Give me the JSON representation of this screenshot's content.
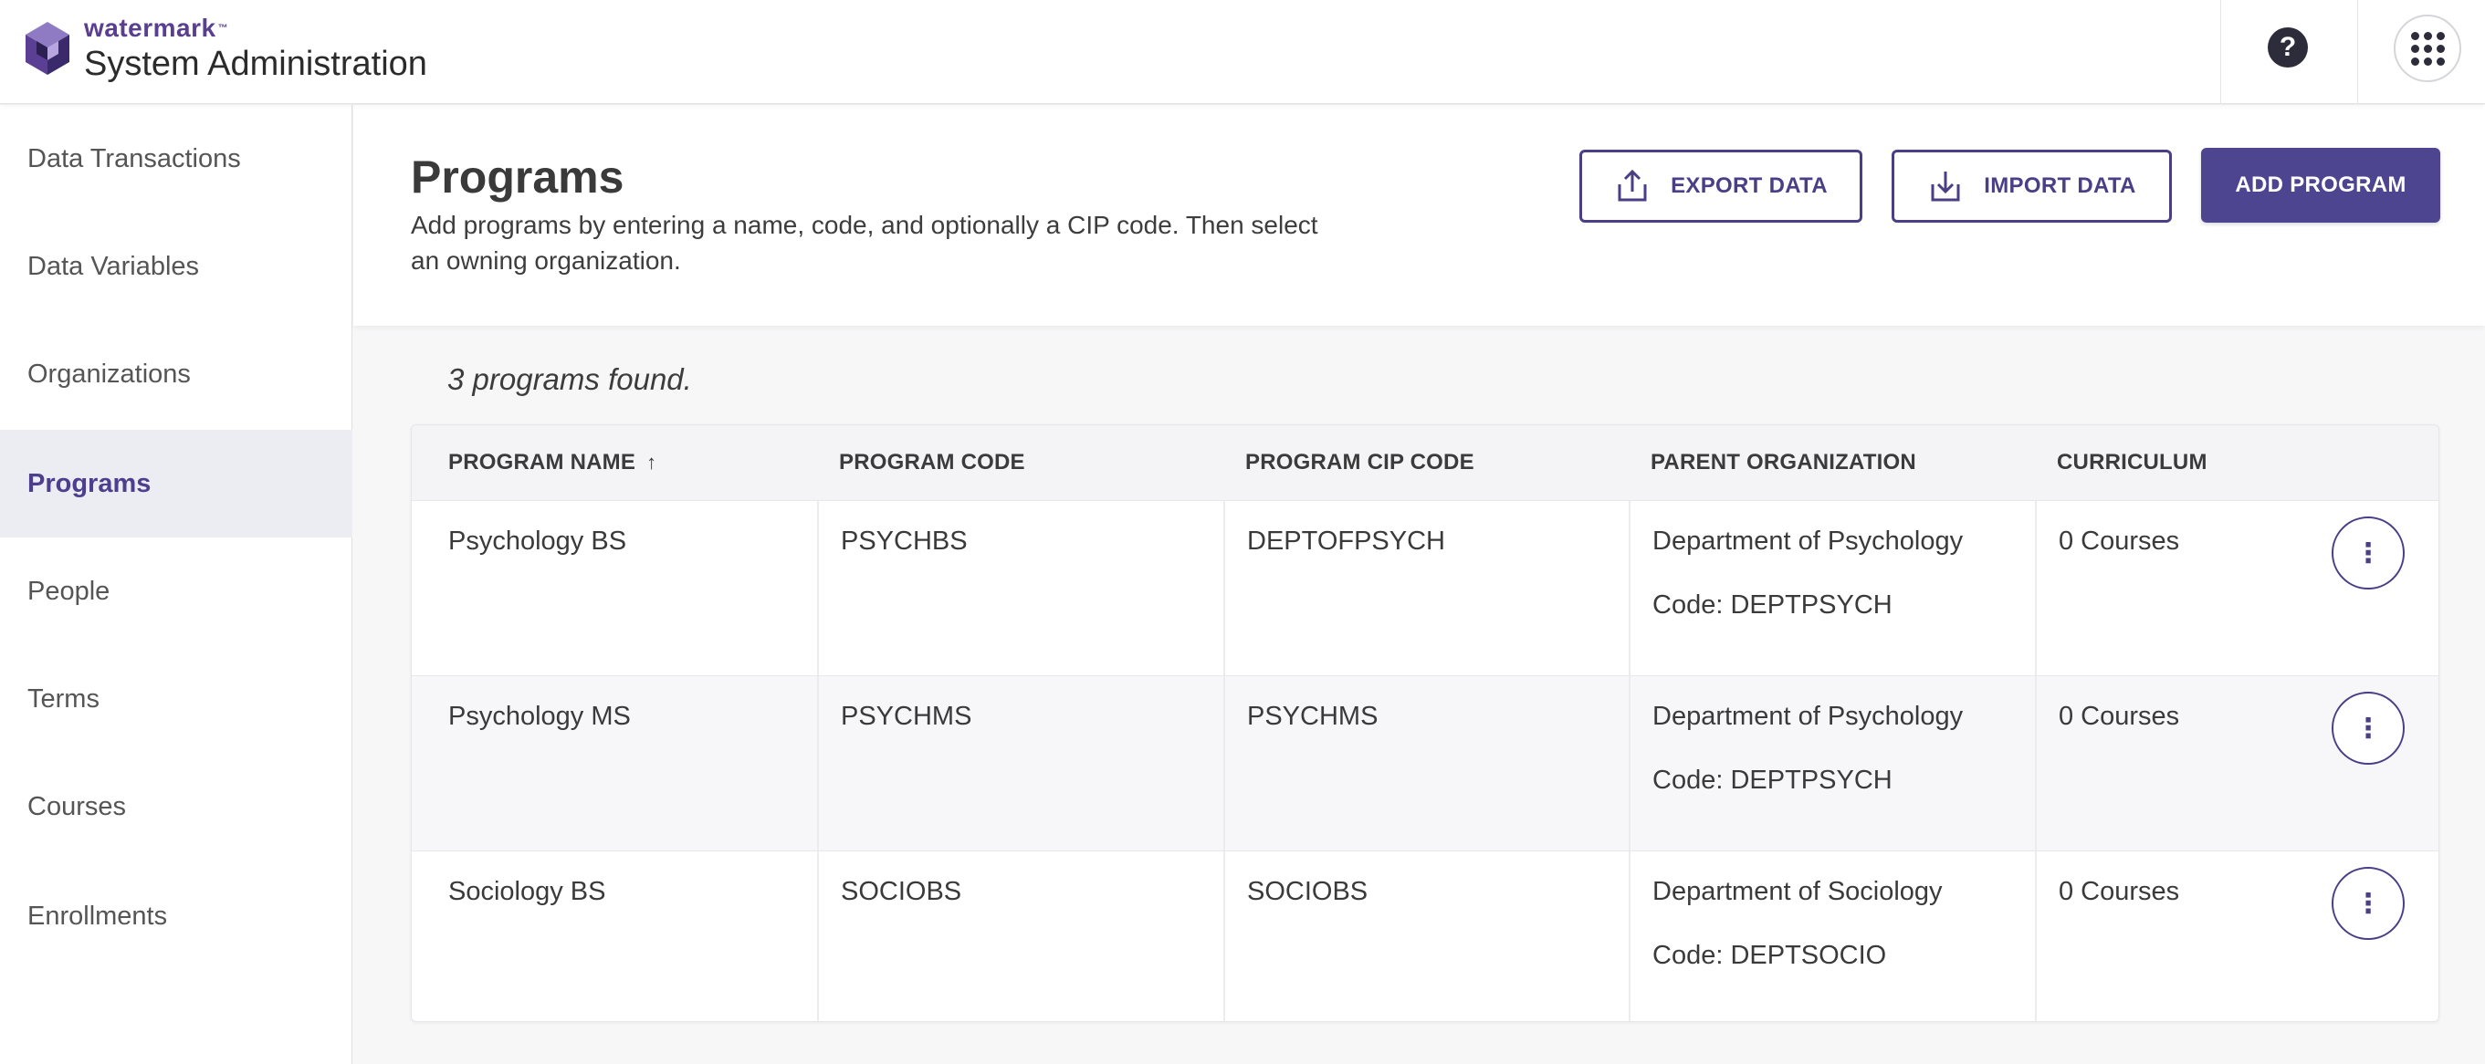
{
  "header": {
    "brand_mark": "watermark",
    "brand_tm": "™",
    "app_title": "System Administration",
    "help_glyph": "?",
    "icons": {
      "logo": "watermark-logo-icon",
      "help": "help-icon",
      "apps": "app-grid-icon"
    }
  },
  "sidebar": {
    "items": [
      {
        "label": "Data Transactions",
        "active": false
      },
      {
        "label": "Data Variables",
        "active": false
      },
      {
        "label": "Organizations",
        "active": false
      },
      {
        "label": "Programs",
        "active": true
      },
      {
        "label": "People",
        "active": false
      },
      {
        "label": "Terms",
        "active": false
      },
      {
        "label": "Courses",
        "active": false
      },
      {
        "label": "Enrollments",
        "active": false
      }
    ]
  },
  "page": {
    "title": "Programs",
    "description": "Add programs by entering a name, code, and optionally a CIP code. Then select an owning organization.",
    "buttons": {
      "export": "EXPORT DATA",
      "import": "IMPORT DATA",
      "add": "ADD PROGRAM"
    },
    "results_text": "3 programs found."
  },
  "table": {
    "columns": {
      "name": "PROGRAM NAME",
      "sort_indicator": "↑",
      "code": "PROGRAM CODE",
      "cip": "PROGRAM CIP CODE",
      "parent": "PARENT ORGANIZATION",
      "curriculum": "CURRICULUM"
    },
    "rows": [
      {
        "name": "Psychology BS",
        "code": "PSYCHBS",
        "cip": "DEPTOFPSYCH",
        "parent_org": "Department of Psychology",
        "parent_code": "Code: DEPTPSYCH",
        "curriculum": "0 Courses",
        "menu": "⋮"
      },
      {
        "name": "Psychology MS",
        "code": "PSYCHMS",
        "cip": "PSYCHMS",
        "parent_org": "Department of Psychology",
        "parent_code": "Code: DEPTPSYCH",
        "curriculum": "0 Courses",
        "menu": "⋮"
      },
      {
        "name": "Sociology BS",
        "code": "SOCIOBS",
        "cip": "SOCIOBS",
        "parent_org": "Department of Sociology",
        "parent_code": "Code: DEPTSOCIO",
        "curriculum": "0 Courses",
        "menu": "⋮"
      }
    ]
  },
  "colors": {
    "brand_purple": "#5a3e8f",
    "accent": "#4e4590",
    "active_nav_bg": "#ececf3"
  }
}
